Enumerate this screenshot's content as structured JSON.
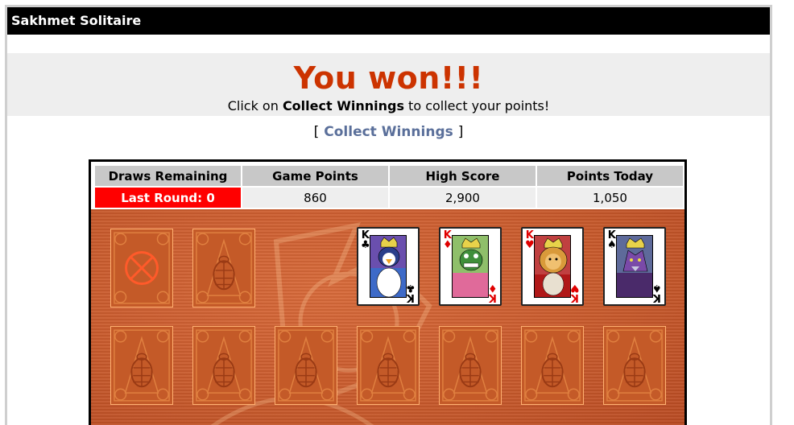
{
  "window": {
    "title": "Sakhmet Solitaire"
  },
  "result": {
    "headline": "You won!!!",
    "instruction_prefix": "Click on ",
    "instruction_bold": "Collect Winnings",
    "instruction_suffix": " to collect your points!"
  },
  "collect": {
    "open_bracket": "[",
    "label": "Collect Winnings",
    "close_bracket": "]"
  },
  "stats": {
    "headers": [
      "Draws Remaining",
      "Game Points",
      "High Score",
      "Points Today"
    ],
    "values": [
      "Last Round: 0",
      "860",
      "2,900",
      "1,050"
    ]
  },
  "foundations": [
    {
      "rank": "K",
      "suit": "♣",
      "color": "black",
      "portrait": "penguin-king"
    },
    {
      "rank": "K",
      "suit": "♦",
      "color": "red",
      "portrait": "lizard-king"
    },
    {
      "rank": "K",
      "suit": "♥",
      "color": "red",
      "portrait": "lion-king"
    },
    {
      "rank": "K",
      "suit": "♠",
      "color": "black",
      "portrait": "wolf-king"
    }
  ],
  "colors": {
    "accent_red": "#cc3300",
    "link": "#5a6f9a",
    "board": "#c85a2c",
    "stat_alert": "#ff0000"
  },
  "icons": {
    "empty_deck": "empty-deck-x-icon",
    "card_back": "scarab-card-back-icon"
  }
}
